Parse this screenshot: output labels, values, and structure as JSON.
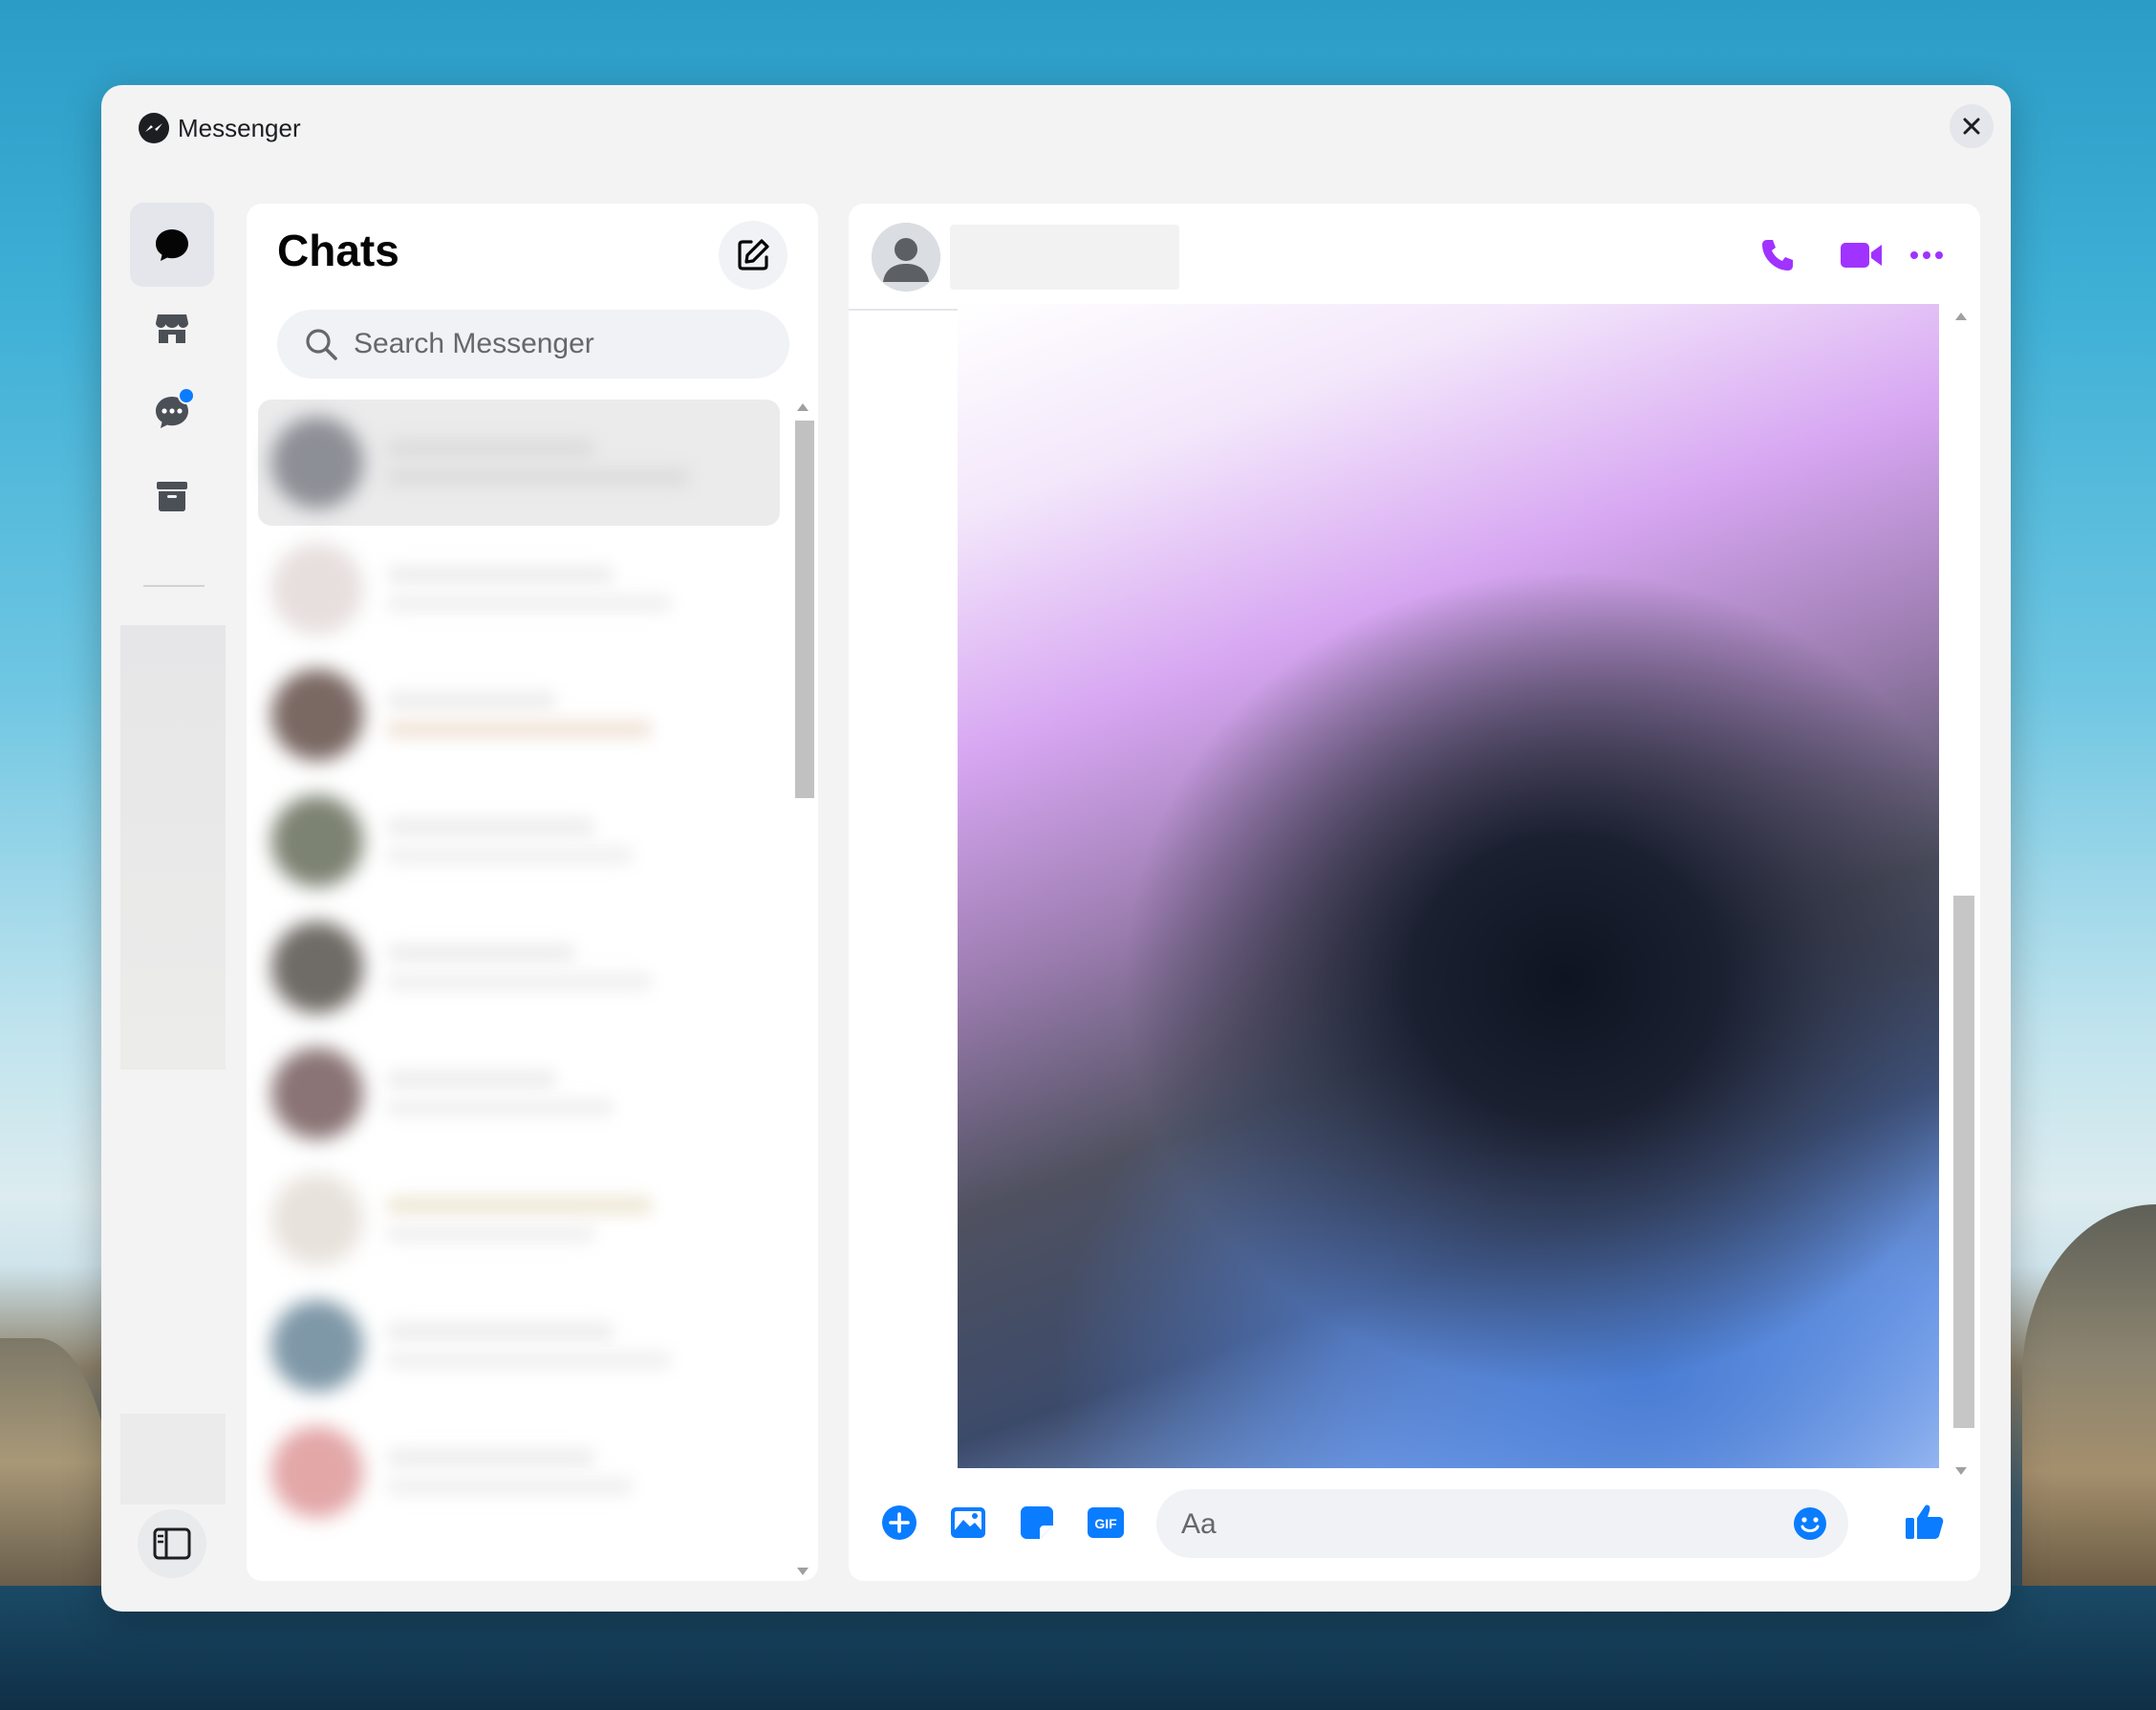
{
  "window": {
    "title": "Messenger",
    "close_icon": "close-icon"
  },
  "rail": {
    "items": [
      {
        "name": "chats",
        "icon": "chat-bubble-icon",
        "active": true
      },
      {
        "name": "marketplace",
        "icon": "store-icon",
        "active": false
      },
      {
        "name": "message-requests",
        "icon": "chat-dots-icon",
        "active": false,
        "has_notification": true
      },
      {
        "name": "archived",
        "icon": "archive-icon",
        "active": false
      }
    ],
    "toggle_sidebar_icon": "sidebar-toggle-icon"
  },
  "chats": {
    "title": "Chats",
    "compose_icon": "compose-icon",
    "search": {
      "placeholder": "Search Messenger",
      "value": ""
    }
  },
  "conversation": {
    "call_icon": "phone-icon",
    "video_icon": "video-camera-icon",
    "more_icon": "more-dots-icon",
    "composer": {
      "placeholder": "Aa",
      "value": "",
      "actions": [
        "plus-icon",
        "photo-icon",
        "sticker-icon",
        "gif-icon"
      ],
      "emoji_icon": "emoji-icon",
      "like_icon": "thumbs-up-icon"
    }
  },
  "colors": {
    "accent_purple": "#a033ff",
    "accent_blue": "#0a7cff",
    "notification_dot": "#0a7cff"
  }
}
